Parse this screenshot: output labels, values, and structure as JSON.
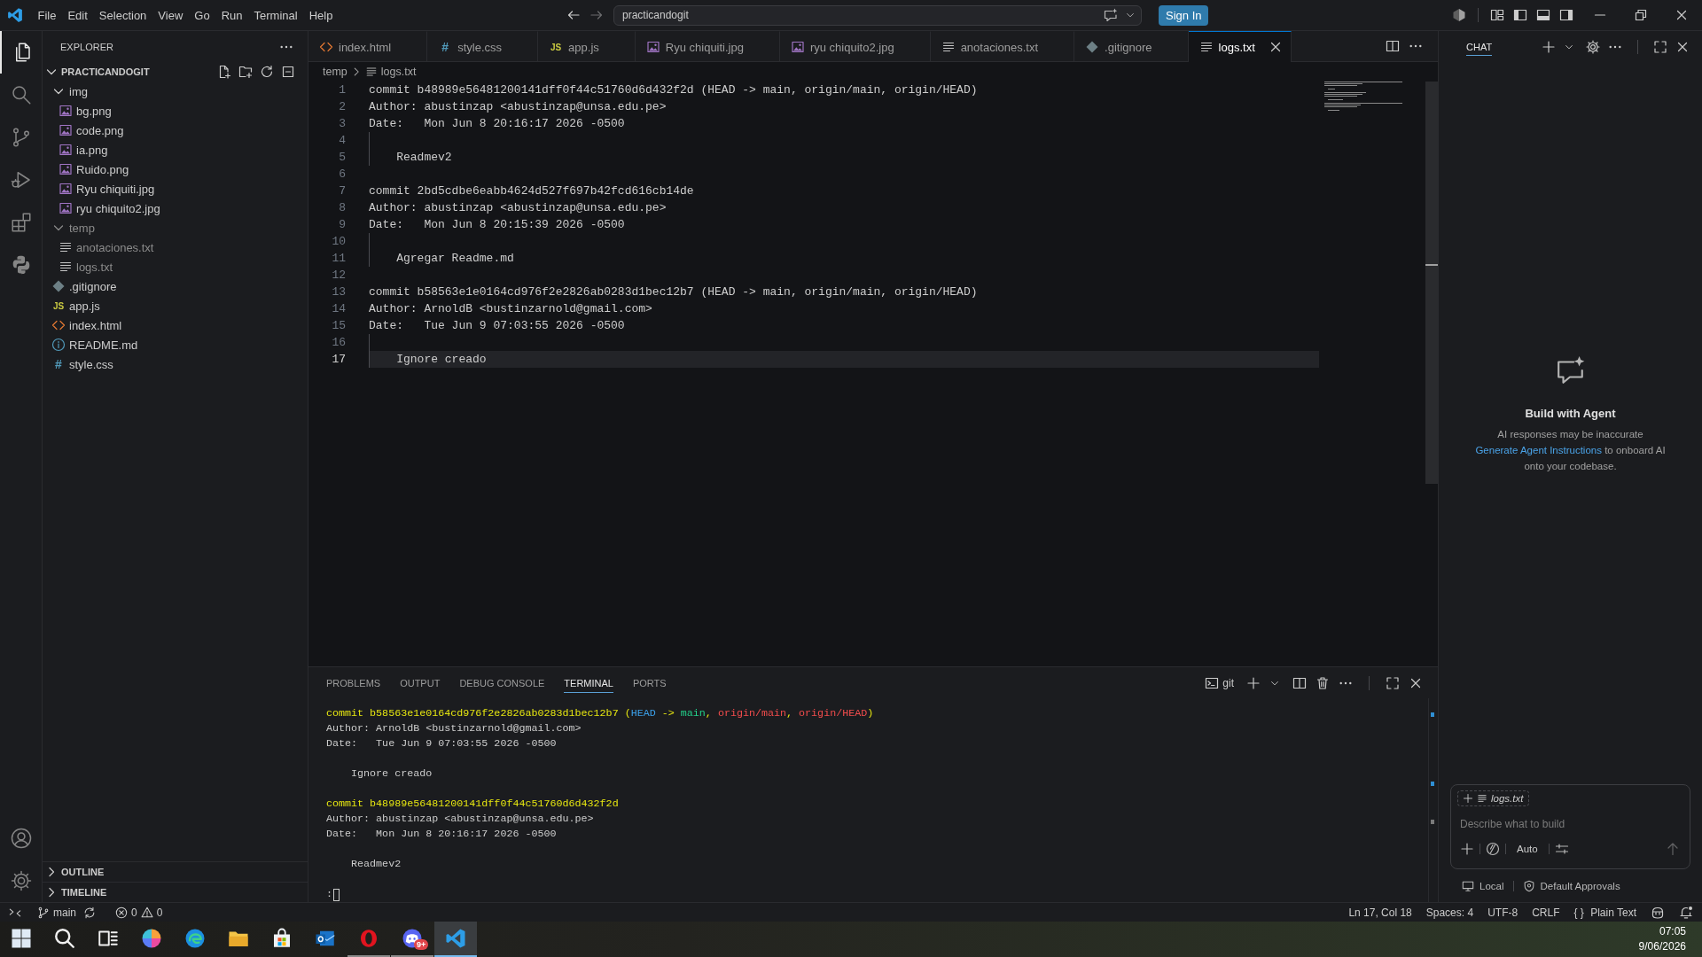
{
  "title_bar": {
    "menu": [
      "File",
      "Edit",
      "Selection",
      "View",
      "Go",
      "Run",
      "Terminal",
      "Help"
    ],
    "nav": [
      {
        "kind": "back",
        "disabled": false
      },
      {
        "kind": "forward",
        "disabled": true
      }
    ],
    "command_center": "practicandogit",
    "sign_in": "Sign In",
    "layout_toggles": [
      {
        "kind": "primary-sidebar",
        "on": true
      },
      {
        "kind": "panel",
        "on": true
      },
      {
        "kind": "secondary-sidebar",
        "on": true
      }
    ]
  },
  "activity_bar": {
    "items": [
      {
        "kind": "explorer",
        "selected": true
      },
      {
        "kind": "search",
        "selected": false
      },
      {
        "kind": "source-control",
        "selected": false
      },
      {
        "kind": "run-debug",
        "selected": false
      },
      {
        "kind": "extensions",
        "selected": false
      },
      {
        "kind": "python",
        "selected": false
      }
    ],
    "bottom": [
      {
        "kind": "account"
      },
      {
        "kind": "settings"
      }
    ]
  },
  "sidebar": {
    "title": "EXPLORER",
    "root": {
      "label": "PRACTICANDOGIT",
      "expanded": true,
      "children": [
        {
          "label": "img",
          "kind": "folder",
          "expanded": true,
          "greyed": false,
          "children": [
            {
              "label": "bg.png",
              "kind": "image",
              "greyed": false
            },
            {
              "label": "code.png",
              "kind": "image",
              "greyed": false
            },
            {
              "label": "ia.png",
              "kind": "image",
              "greyed": false
            },
            {
              "label": "Ruido.png",
              "kind": "image",
              "greyed": false
            },
            {
              "label": "Ryu chiquiti.jpg",
              "kind": "image",
              "greyed": false
            },
            {
              "label": "ryu chiquito2.jpg",
              "kind": "image",
              "greyed": false
            }
          ]
        },
        {
          "label": "temp",
          "kind": "folder",
          "expanded": true,
          "greyed": true,
          "children": [
            {
              "label": "anotaciones.txt",
              "kind": "text",
              "greyed": true
            },
            {
              "label": "logs.txt",
              "kind": "text",
              "greyed": true
            }
          ]
        },
        {
          "label": ".gitignore",
          "kind": "git",
          "greyed": false
        },
        {
          "label": "app.js",
          "kind": "js",
          "glyph": "JS",
          "greyed": false
        },
        {
          "label": "index.html",
          "kind": "html",
          "greyed": false
        },
        {
          "label": "README.md",
          "kind": "info",
          "greyed": false
        },
        {
          "label": "style.css",
          "kind": "css",
          "glyph": "#",
          "greyed": false
        }
      ]
    },
    "sections": [
      {
        "label": "OUTLINE",
        "expanded": false
      },
      {
        "label": "TIMELINE",
        "expanded": false
      }
    ]
  },
  "tabs": [
    {
      "label": "index.html",
      "kind": "html",
      "selected": false
    },
    {
      "label": "style.css",
      "kind": "css",
      "glyph": "#",
      "selected": false
    },
    {
      "label": "app.js",
      "kind": "js",
      "glyph": "JS",
      "selected": false
    },
    {
      "label": "Ryu chiquiti.jpg",
      "kind": "image",
      "selected": false
    },
    {
      "label": "ryu chiquito2.jpg",
      "kind": "image",
      "selected": false
    },
    {
      "label": "anotaciones.txt",
      "kind": "text",
      "selected": false
    },
    {
      "label": ".gitignore",
      "kind": "git",
      "selected": false
    },
    {
      "label": "logs.txt",
      "kind": "text",
      "selected": true
    }
  ],
  "breadcrumb": [
    {
      "label": "temp",
      "kind": "folder"
    },
    {
      "label": "logs.txt",
      "kind": "text"
    }
  ],
  "editor": {
    "lines": [
      {
        "number": "1",
        "text": "commit b48989e56481200141dff0f44c51760d6d432f2d (HEAD -> main, origin/main, origin/HEAD)",
        "indented": false,
        "current": false
      },
      {
        "number": "2",
        "text": "Author: abustinzap <abustinzap@unsa.edu.pe>",
        "indented": false,
        "current": false
      },
      {
        "number": "3",
        "text": "Date:   Mon Jun 8 20:16:17 2026 -0500",
        "indented": false,
        "current": false
      },
      {
        "number": "4",
        "indented": true,
        "current": false
      },
      {
        "number": "5",
        "text": "Readmev2",
        "indented": true,
        "current": false
      },
      {
        "number": "6",
        "indented": false,
        "current": false
      },
      {
        "number": "7",
        "text": "commit 2bd5cdbe6eabb4624d527f697b42fcd616cb14de",
        "indented": false,
        "current": false
      },
      {
        "number": "8",
        "text": "Author: abustinzap <abustinzap@unsa.edu.pe>",
        "indented": false,
        "current": false
      },
      {
        "number": "9",
        "text": "Date:   Mon Jun 8 20:15:39 2026 -0500",
        "indented": false,
        "current": false
      },
      {
        "number": "10",
        "indented": true,
        "current": false
      },
      {
        "number": "11",
        "text": "Agregar Readme.md",
        "indented": true,
        "current": false
      },
      {
        "number": "12",
        "indented": false,
        "current": false
      },
      {
        "number": "13",
        "text": "commit b58563e1e0164cd976f2e2826ab0283d1bec12b7 (HEAD -> main, origin/main, origin/HEAD)",
        "indented": false,
        "current": false
      },
      {
        "number": "14",
        "text": "Author: ArnoldB <bustinzarnold@gmail.com>",
        "indented": false,
        "current": false
      },
      {
        "number": "15",
        "text": "Date:   Tue Jun 9 07:03:55 2026 -0500",
        "indented": false,
        "current": false
      },
      {
        "number": "16",
        "indented": true,
        "current": false
      },
      {
        "number": "17",
        "text": "Ignore creado",
        "indented": true,
        "current": true
      }
    ]
  },
  "panel": {
    "tabs": [
      {
        "label": "PROBLEMS",
        "selected": false
      },
      {
        "label": "OUTPUT",
        "selected": false
      },
      {
        "label": "DEBUG CONSOLE",
        "selected": false
      },
      {
        "label": "TERMINAL",
        "selected": true
      },
      {
        "label": "PORTS",
        "selected": false
      }
    ],
    "terminal_name": "git",
    "commits": [
      {
        "header": {
          "color": "#e5e510",
          "parts": [
            {
              "text": "commit b58563e1e0164cd976f2e2826ab0283d1bec12b7 ("
            },
            {
              "text": "HEAD",
              "color": "#3b9fe8"
            },
            {
              "text": " -> "
            },
            {
              "text": "main",
              "color": "#23d18b"
            },
            {
              "text": ", "
            },
            {
              "text": "origin/main",
              "color": "#f14c4c"
            },
            {
              "text": ", "
            },
            {
              "text": "origin/HEAD",
              "color": "#f14c4c"
            },
            {
              "text": ")"
            }
          ]
        },
        "author": "Author: ArnoldB <bustinzarnold@gmail.com>",
        "date": "Date:   Tue Jun 9 07:03:55 2026 -0500",
        "message": "Ignore creado"
      },
      {
        "header": {
          "color": "#e5e510",
          "parts": [
            {
              "text": "commit b48989e56481200141dff0f44c51760d6d432f2d"
            }
          ]
        },
        "author": "Author: abustinzap <abustinzap@unsa.edu.pe>",
        "date": "Date:   Mon Jun 8 20:16:17 2026 -0500",
        "message": "Readmev2"
      }
    ],
    "prompt": ":"
  },
  "chat": {
    "title": "CHAT",
    "heading": "Build with Agent",
    "disclaimer": "AI responses may be inaccurate",
    "link": "Generate Agent Instructions",
    "link_rest": "to onboard AI onto your codebase.",
    "input": {
      "attachment": "logs.txt",
      "placeholder": "Describe what to build",
      "mode": "Auto",
      "send_disabled": true
    },
    "location": "Local",
    "approvals": "Default Approvals"
  },
  "status_bar": {
    "branch": "main",
    "errors": "0",
    "warnings": "0",
    "position": "Ln 17, Col 18",
    "indentation": "Spaces: 4",
    "encoding": "UTF-8",
    "line_ending": "CRLF",
    "language_icon": "{ }",
    "language": "Plain Text"
  },
  "taskbar": {
    "apps": [
      {
        "kind": "start",
        "running": false,
        "selected": false
      },
      {
        "kind": "search",
        "running": false,
        "selected": false
      },
      {
        "kind": "task-view",
        "running": false,
        "selected": false
      },
      {
        "kind": "swirl",
        "running": false,
        "selected": false
      },
      {
        "kind": "browser",
        "running": false,
        "selected": false
      },
      {
        "kind": "folder",
        "running": false,
        "selected": false
      },
      {
        "kind": "store",
        "running": false,
        "selected": false
      },
      {
        "kind": "mail",
        "running": false,
        "selected": false
      },
      {
        "kind": "ring",
        "running": true,
        "selected": false
      },
      {
        "kind": "chat",
        "running": true,
        "selected": false,
        "badge": "9+"
      },
      {
        "kind": "editor",
        "running": true,
        "selected": true
      }
    ],
    "time": "07:05",
    "date": "9/06/2026"
  }
}
